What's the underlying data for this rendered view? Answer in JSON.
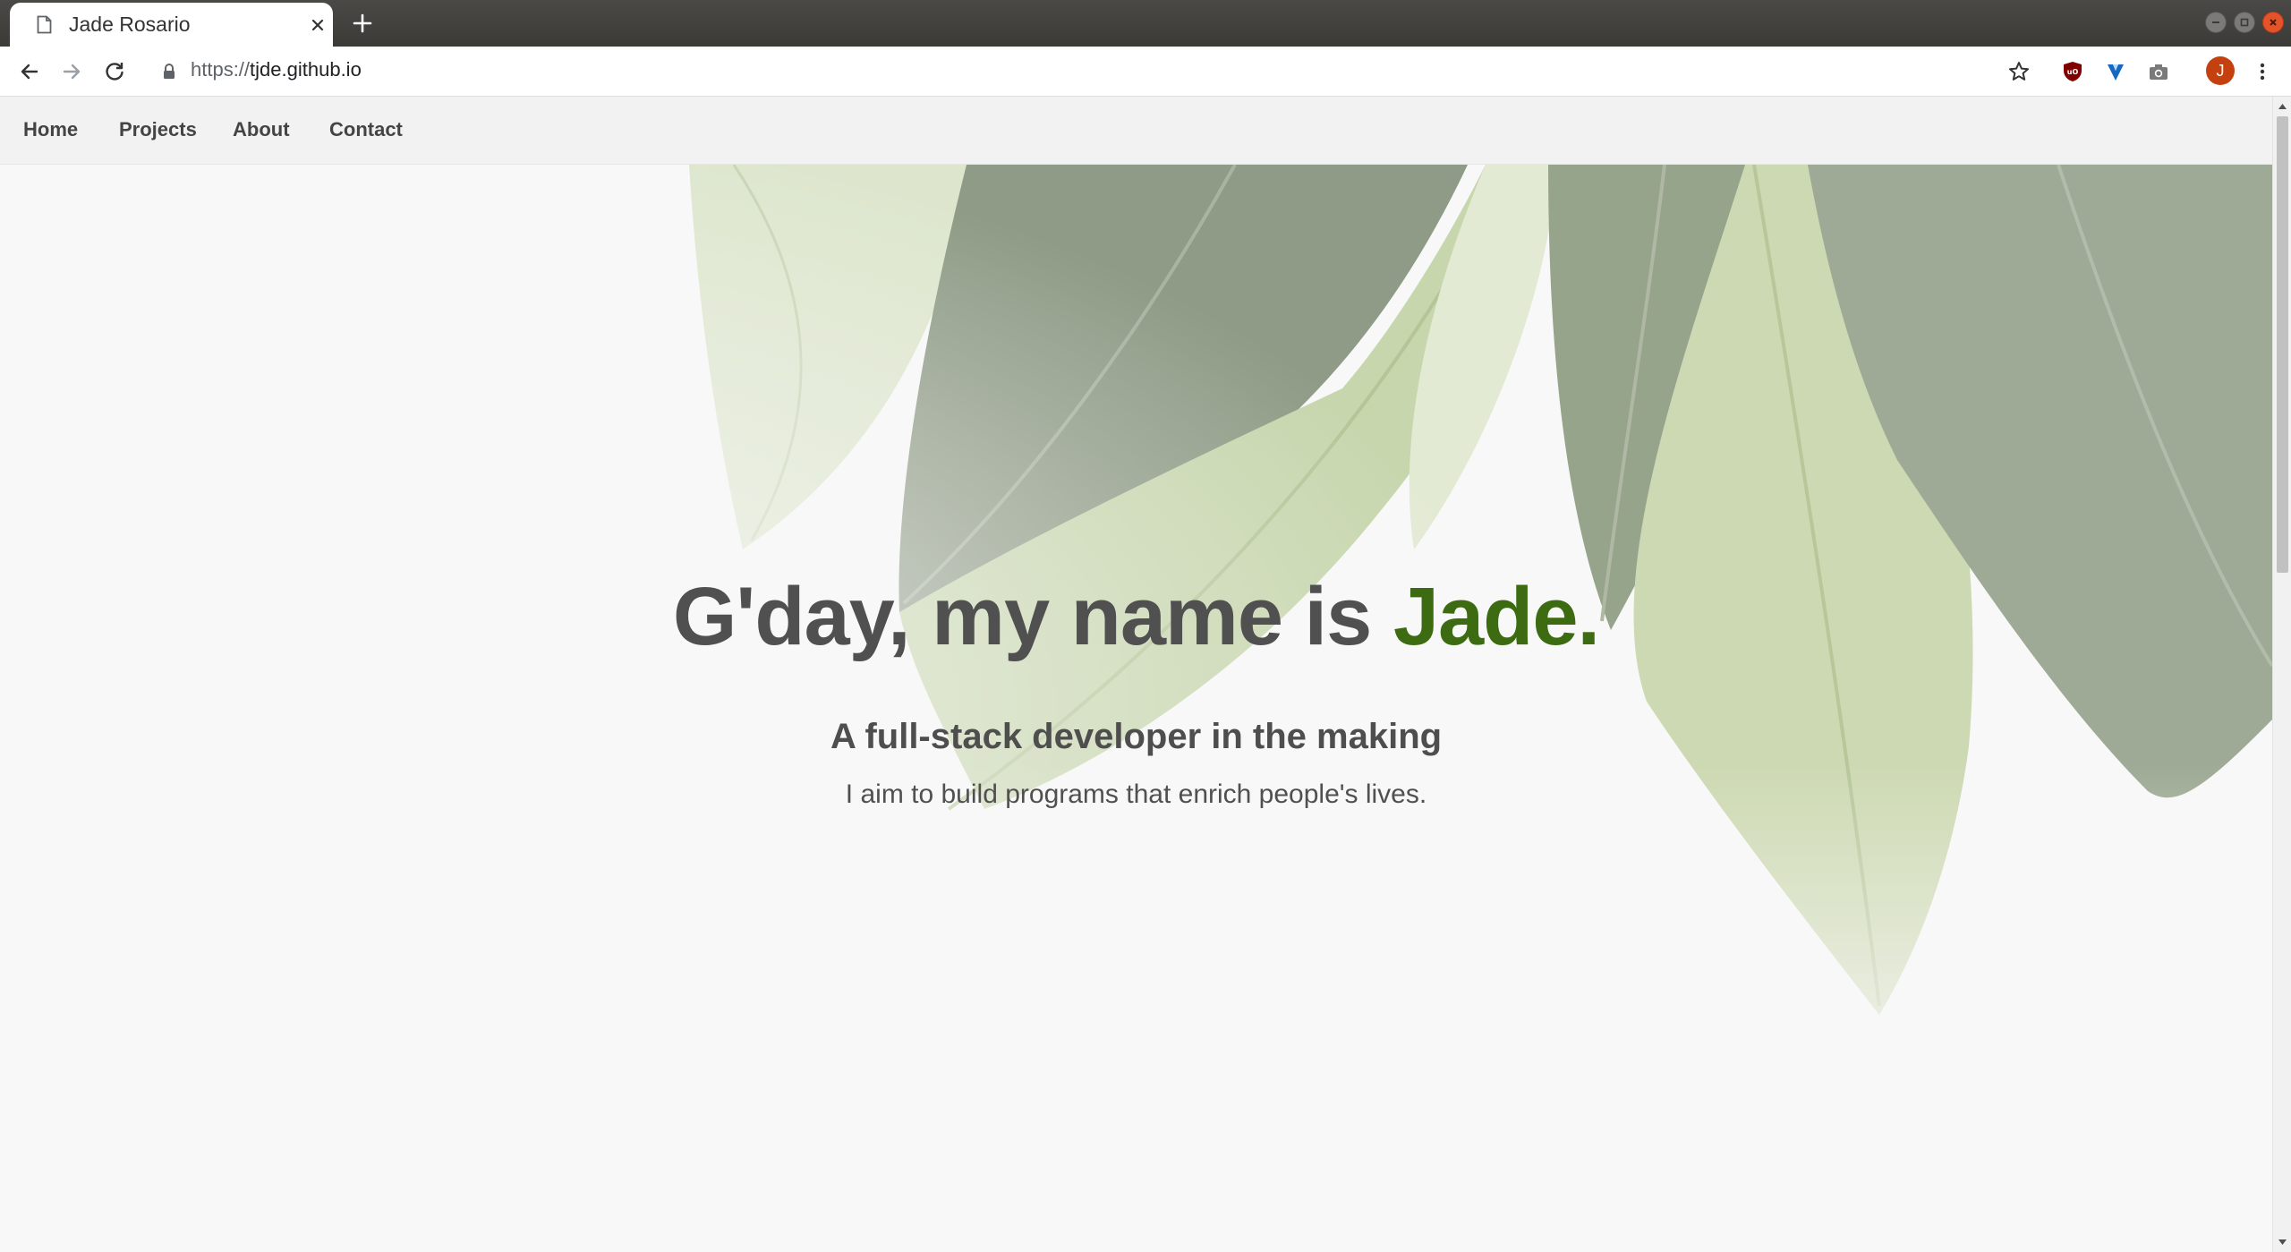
{
  "browser": {
    "tab_title": "Jade Rosario",
    "url_scheme": "https://",
    "url_host": "tjde.github.io",
    "profile_initial": "J",
    "icons": [
      "page-icon",
      "close-icon",
      "plus-icon",
      "back-icon",
      "forward-icon",
      "reload-icon",
      "lock-icon",
      "star-icon",
      "ublock-icon",
      "vuetify-icon",
      "camera-icon",
      "kebab-menu-icon",
      "minimize-icon",
      "maximize-icon",
      "close-window-icon"
    ]
  },
  "site": {
    "nav": {
      "home": "Home",
      "projects": "Projects",
      "about": "About",
      "contact": "Contact"
    },
    "hero": {
      "greeting": "G'day, my name is ",
      "name": "Jade.",
      "subtitle": "A full-stack developer in the making",
      "tagline": "I aim to build programs that enrich people's lives."
    }
  },
  "colors": {
    "accent_green": "#3d6b12",
    "heading_gray": "#505050",
    "nav_bg": "#f2f2f2",
    "page_bg": "#f8f8f8",
    "avatar_bg": "#c5400f"
  }
}
